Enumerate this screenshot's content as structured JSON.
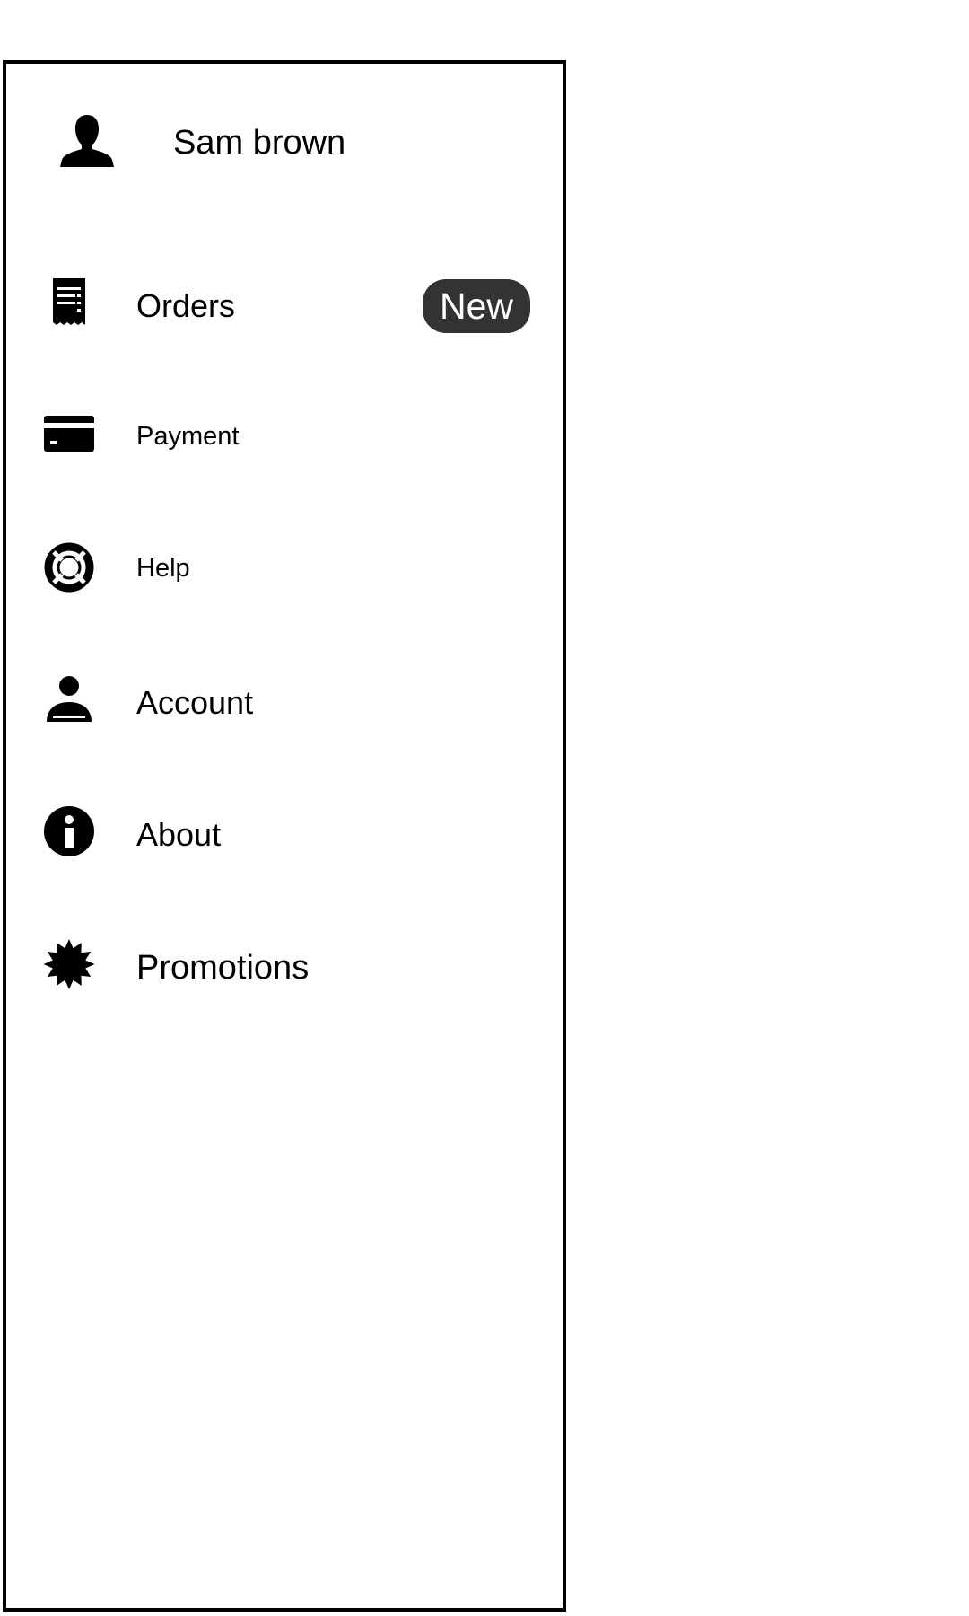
{
  "profile": {
    "name": "Sam brown",
    "avatar_icon": "user-silhouette-icon"
  },
  "menu": {
    "orders": {
      "label": "Orders",
      "icon": "receipt-icon",
      "badge": "New"
    },
    "payment": {
      "label": "Payment",
      "icon": "credit-card-icon"
    },
    "help": {
      "label": "Help",
      "icon": "lifebuoy-icon"
    },
    "account": {
      "label": "Account",
      "icon": "person-icon"
    },
    "about": {
      "label": "About",
      "icon": "info-icon"
    },
    "promotions": {
      "label": "Promotions",
      "icon": "badge-star-icon"
    }
  },
  "colors": {
    "badge_background": "#333333",
    "badge_text": "#ffffff",
    "border": "#000000"
  }
}
